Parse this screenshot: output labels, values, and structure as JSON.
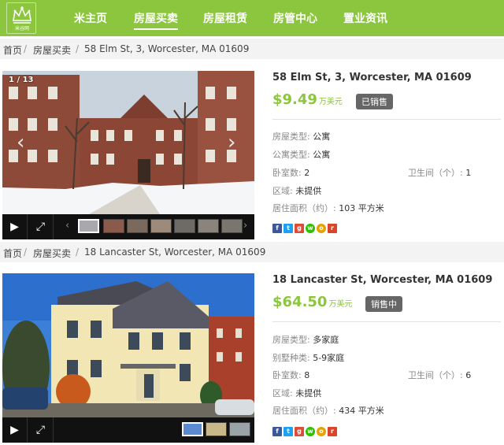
{
  "nav": {
    "logo_text": "米谷网",
    "items": [
      "米主页",
      "房屋买卖",
      "房屋租赁",
      "房管中心",
      "置业资讯"
    ],
    "active": "房屋买卖"
  },
  "listings": [
    {
      "breadcrumb": [
        "首页",
        "房屋买卖",
        "58 Elm St, 3, Worcester, MA 01609"
      ],
      "address": "58 Elm St, 3, Worcester, MA 01609",
      "price": "$9.49",
      "price_unit": "万美元",
      "status": "已销售",
      "counter": "1 / 13",
      "fields": [
        {
          "label": "房屋类型:",
          "value": "公寓"
        },
        {
          "label": "公寓类型:",
          "value": "公寓"
        },
        {
          "label": "卧室数:",
          "value": "2"
        },
        {
          "label": "区域:",
          "value": "未提供"
        },
        {
          "label": "居住面积（约）:",
          "value": "103 平方米"
        }
      ],
      "bath": {
        "label": "卫生间（个）:",
        "value": "1"
      }
    },
    {
      "breadcrumb": [
        "首页",
        "房屋买卖",
        "18 Lancaster St, Worcester, MA 01609"
      ],
      "address": "18 Lancaster St, Worcester, MA 01609",
      "price": "$64.50",
      "price_unit": "万美元",
      "status": "销售中",
      "fields": [
        {
          "label": "房屋类型:",
          "value": "多家庭"
        },
        {
          "label": "别墅种类:",
          "value": "5-9家庭"
        },
        {
          "label": "卧室数:",
          "value": "8"
        },
        {
          "label": "区域:",
          "value": "未提供"
        },
        {
          "label": "居住面积（约）:",
          "value": "434 平方米"
        }
      ],
      "bath": {
        "label": "卫生间（个）:",
        "value": "6"
      }
    }
  ],
  "share_icons": [
    "facebook-icon",
    "twitter-icon",
    "google-plus-icon",
    "wechat-icon",
    "weibo-icon",
    "renren-icon"
  ],
  "colors": {
    "brand_green": "#8cc63f",
    "badge_gray": "#666666"
  }
}
